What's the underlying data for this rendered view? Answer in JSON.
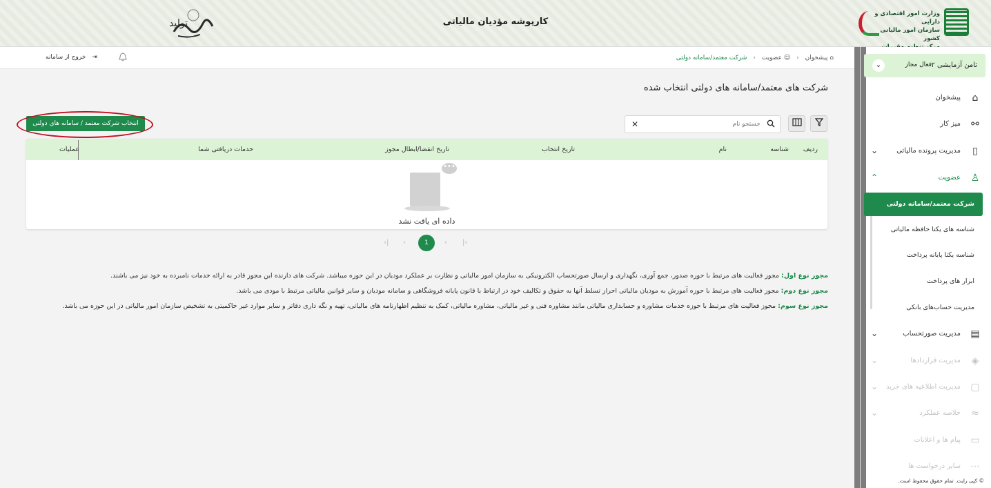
{
  "header": {
    "title": "کارپوشه مؤدیان مالیاتی",
    "org_lines": [
      "وزارت امور اقتصادی و دارایی",
      "سازمان امور مالیاتی کشور",
      "مرکز تنظیم مقررات"
    ],
    "slogan": "تولید"
  },
  "profile": {
    "name": "ثامن آزمایشی ۲",
    "role": "فعال مجاز"
  },
  "sidebar": {
    "items": [
      {
        "label": "پیشخوان",
        "icon": "home-icon"
      },
      {
        "label": "میز کار",
        "icon": "workflow-icon"
      },
      {
        "label": "مدیریت پرونده مالیاتی",
        "icon": "document-icon"
      },
      {
        "label": "عضویت",
        "icon": "user-icon"
      },
      {
        "label": "مدیریت صورتحساب",
        "icon": "receipt-icon"
      },
      {
        "label": "مدیریت قراردادها",
        "icon": "handshake-icon"
      },
      {
        "label": "مدیریت اطلاعیه های خرید",
        "icon": "bag-icon"
      },
      {
        "label": "خلاصه عملکرد",
        "icon": "chart-icon"
      },
      {
        "label": "پیام ها و اعلانات",
        "icon": "message-icon"
      },
      {
        "label": "سایر درخواست ها",
        "icon": "more-icon"
      }
    ],
    "sub_items": [
      "شرکت معتمد/سامانه دولتی",
      "شناسه های یکتا حافظه مالیاتی",
      "شناسه یکتا پایانه پرداخت",
      "ابزار های پرداخت",
      "مدیریت حساب‌های بانکی"
    ],
    "copyright": "© کپی رایت. تمام حقوق محفوظ است."
  },
  "topbar": {
    "breadcrumb": [
      "پیشخوان",
      "عضویت",
      "شرکت معتمد/سامانه دولتی"
    ],
    "logout": "خروج از سامانه"
  },
  "main": {
    "page_title": "شرکت های معتمد/سامانه های دولتی انتخاب شده",
    "select_button": "انتخاب شرکت معتمد / سامانه های دولتی",
    "search_placeholder": "جستجو نام",
    "columns": [
      "ردیف",
      "شناسه",
      "نام",
      "تاریخ انتخاب",
      "تاریخ انقضا/ابطال مجوز",
      "خدمات دریافتی شما",
      "عملیات"
    ],
    "empty_text": "داده ای یافت نشد",
    "current_page": "1",
    "notes": [
      {
        "title": "مجوز نوع اول:",
        "text": " مجوز فعالیت های مرتبط با حوزه صدور، جمع آوری، نگهداری و ارسال صورتحساب الکترونیکی به سازمان امور مالیاتی و نظارت بر عملکرد مودیان در این حوزه میباشد. شرکت های دارنده این مجوز قادر به ارائه خدمات نامبرده به خود نیز می باشند."
      },
      {
        "title": "مجوز نوع دوم:",
        "text": " مجوز فعالیت های مرتبط با حوزه آموزش به مودیان مالیاتی احراز تسلط آنها به حقوق و تکالیف خود در ارتباط با قانون پایانه فروشگاهی و سامانه مودیان و سایر قوانین مالیاتی مرتبط با مودی می باشد."
      },
      {
        "title": "مجوز نوع سوم:",
        "text": " مجوز فعالیت های مرتبط با حوزه خدمات مشاوره و حسابداری مالیاتی مانند مشاوره فنی و غیر مالیاتی، مشاوره مالیاتی، کمک به تنظیم اظهارنامه های مالیاتی، تهیه و نگه داری دفاتر و سایر موارد غیر حاکمیتی به تشخیص سازمان امور مالیاتی در این حوزه می باشد."
      }
    ]
  },
  "colors": {
    "primary": "#1e8a4c",
    "header_green": "#dcf3d6",
    "annotation_red": "#c1121f"
  }
}
